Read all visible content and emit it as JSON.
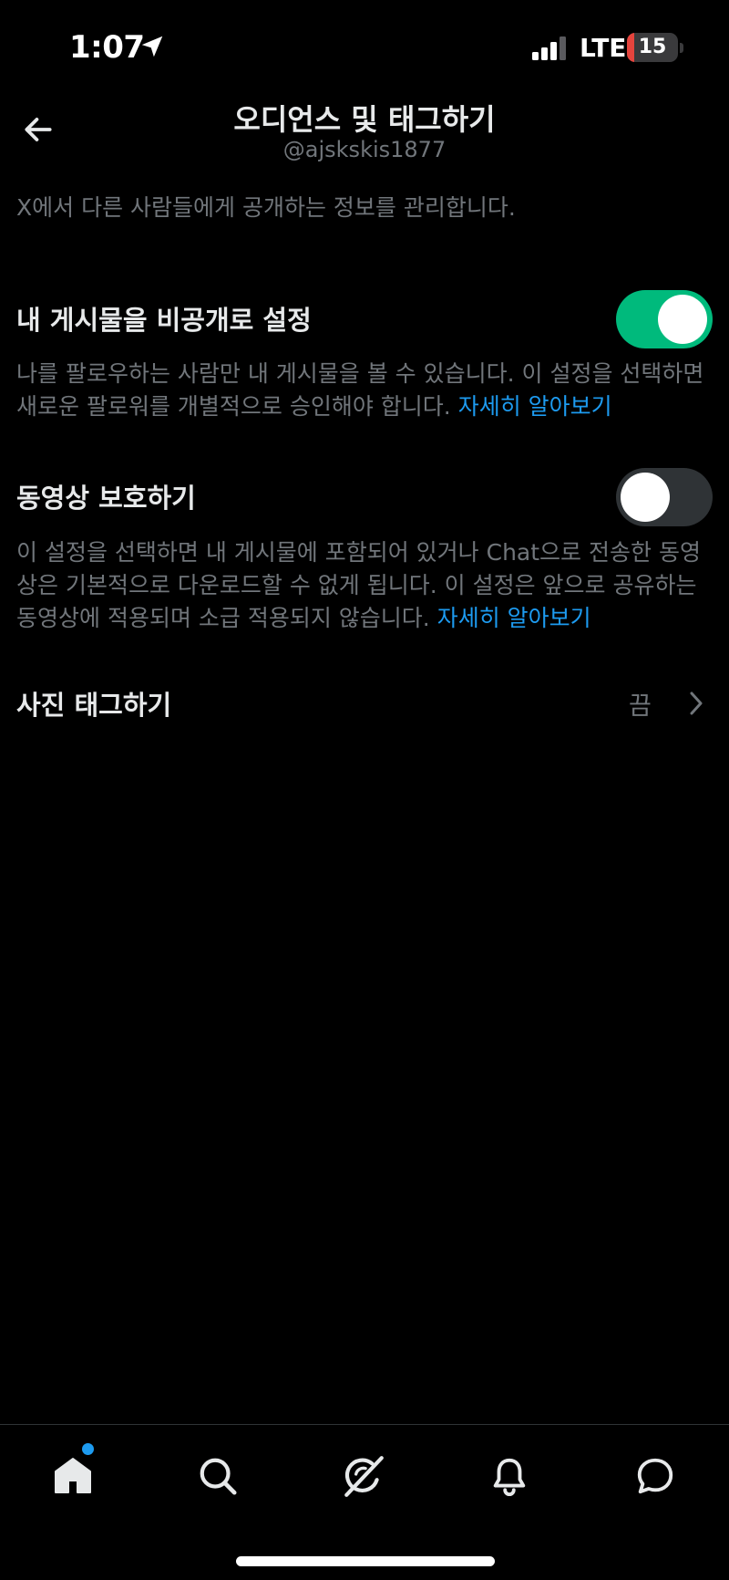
{
  "status_bar": {
    "time": "1:07",
    "network": "LTE",
    "battery_level": "15",
    "battery_fraction": 0.15,
    "location_icon": "location-arrow-icon",
    "signal_icon": "cellular-signal-icon"
  },
  "header": {
    "title": "오디언스 및 태그하기",
    "subtitle": "@ajskskis1877",
    "back_icon": "arrow-left-icon"
  },
  "intro": "X에서 다른 사람들에게 공개하는 정보를 관리합니다.",
  "settings": [
    {
      "title": "내 게시물을 비공개로 설정",
      "description": "나를 팔로우하는 사람만 내 게시물을 볼 수 있습니다. 이 설정을 선택하면 새로운 팔로워를 개별적으로 승인해야 합니다. ",
      "link": "자세히 알아보기",
      "enabled": true
    },
    {
      "title": "동영상 보호하기",
      "description": "이 설정을 선택하면 내 게시물에 포함되어 있거나 Chat으로 전송한 동영상은 기본적으로 다운로드할 수 없게 됩니다. 이 설정은 앞으로 공유하는 동영상에 적용되며 소급 적용되지 않습니다. ",
      "link": "자세히 알아보기",
      "enabled": false
    }
  ],
  "photo_tagging": {
    "title": "사진 태그하기",
    "value": "끔",
    "icon": "chevron-right-icon"
  },
  "bottom_nav": {
    "items": [
      "home-icon",
      "search-icon",
      "grok-icon",
      "notifications-bell-icon",
      "chat-icon"
    ],
    "active": "home-icon",
    "has_notification_dot": true
  },
  "colors": {
    "background": "#000000",
    "text_primary": "#e7e9ea",
    "text_secondary": "#71767b",
    "link": "#1d9bf0",
    "toggle_on": "#00ba7c",
    "toggle_off": "#2f3336",
    "battery_low": "#e5443d"
  }
}
